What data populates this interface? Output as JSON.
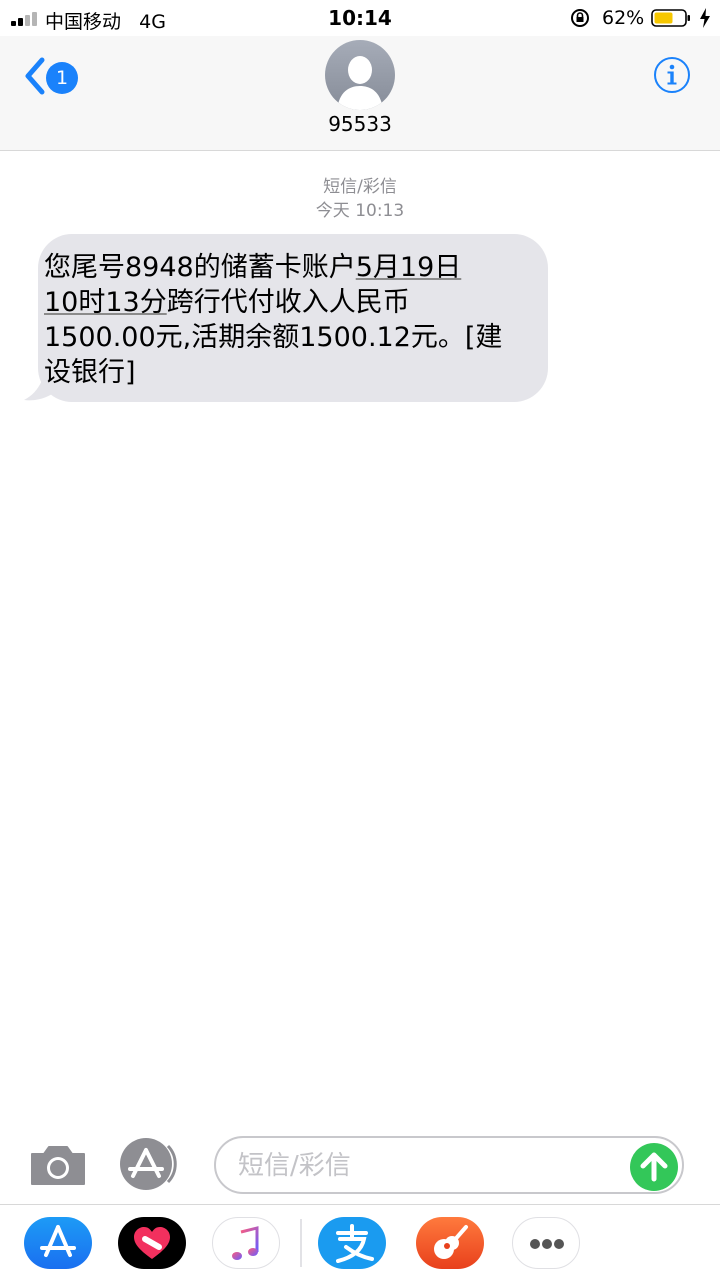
{
  "status_bar": {
    "carrier": "中国移动",
    "network": "4G",
    "time": "10:14",
    "battery_percent": "62%",
    "battery_level": 0.62
  },
  "header": {
    "unread_count": "1",
    "contact_name": "95533"
  },
  "conversation": {
    "message_type": "短信/彩信",
    "timestamp": "今天 10:13",
    "message": {
      "line1_a": "您尾号8948的储蓄卡账户",
      "line1_b": "5月19日",
      "line2_a": "10时13分",
      "line2_b": "跨行代付收入人民币",
      "line3": "1500.00元,活期余额1500.12元。[建",
      "line4": "设银行]"
    }
  },
  "input_bar": {
    "placeholder": "短信/彩信"
  },
  "app_drawer": {
    "apps": [
      "app-store",
      "digital-touch",
      "music",
      "alipay",
      "garageband",
      "more"
    ]
  },
  "colors": {
    "accent_blue": "#1a82fb",
    "bubble_gray": "#e5e5ea",
    "send_green": "#33c759"
  }
}
